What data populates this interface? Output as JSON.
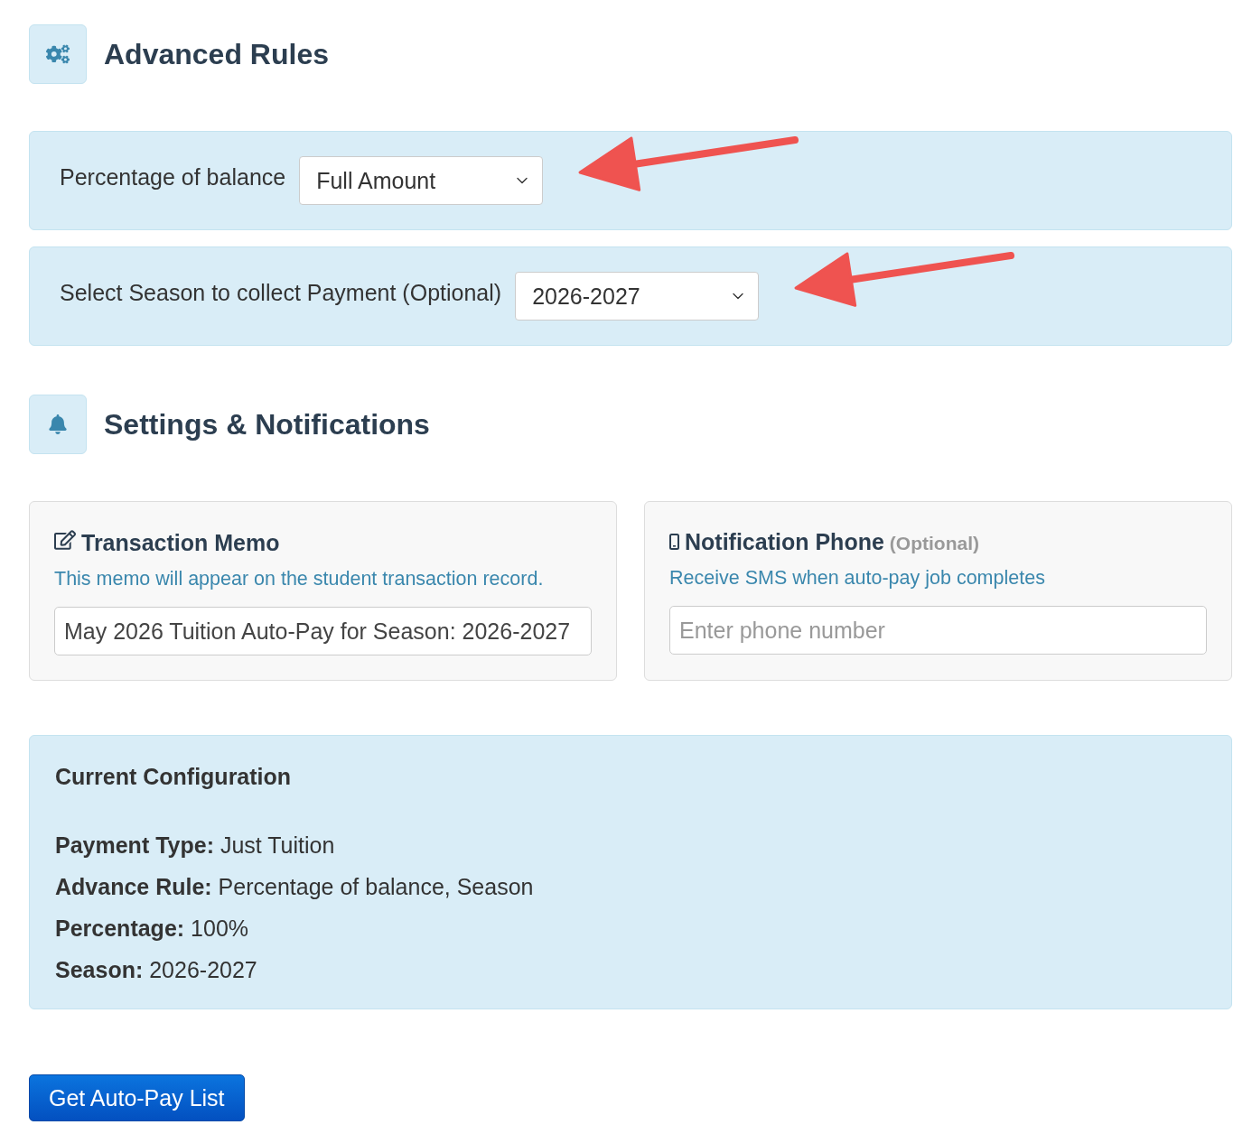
{
  "advanced_rules": {
    "title": "Advanced Rules",
    "rules": [
      {
        "label": "Percentage of balance",
        "value": "Full Amount",
        "arrow": true
      },
      {
        "label": "Select Season to collect Payment (Optional)",
        "value": "2026-2027",
        "arrow": true
      }
    ]
  },
  "settings": {
    "title": "Settings & Notifications",
    "cards": [
      {
        "kind": "memo",
        "title": "Transaction Memo",
        "help": "This memo will appear on the student transaction record.",
        "value": "May 2026 Tuition Auto-Pay for Season: 2026-2027"
      },
      {
        "kind": "phone",
        "title": "Notification Phone",
        "note": "(Optional)",
        "help": "Receive SMS when auto-pay job completes",
        "placeholder": "Enter phone number"
      }
    ]
  },
  "configuration": {
    "title": "Current Configuration",
    "lines": [
      "**Payment Type:** Just Tuition",
      "**Advance Rule:** Percentage of balance, Season",
      "**Percentage:** 100%",
      "**Season:** 2026-2027"
    ]
  },
  "submit_button": {
    "label": "Get Auto-Pay List"
  }
}
